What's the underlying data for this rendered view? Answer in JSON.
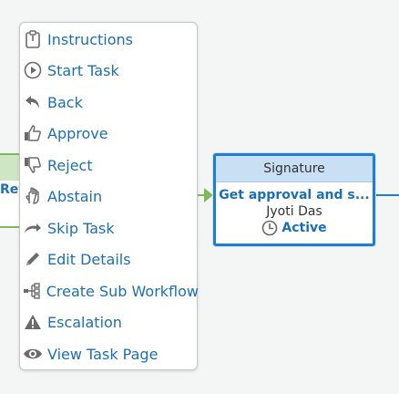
{
  "menu": {
    "items": [
      {
        "label": "Instructions",
        "icon": "clipboard-icon"
      },
      {
        "label": "Start Task",
        "icon": "play-circle-icon"
      },
      {
        "label": "Back",
        "icon": "reply-arrow-icon"
      },
      {
        "label": "Approve",
        "icon": "thumbs-up-icon"
      },
      {
        "label": "Reject",
        "icon": "thumbs-down-icon"
      },
      {
        "label": "Abstain",
        "icon": "hand-icon"
      },
      {
        "label": "Skip Task",
        "icon": "skip-arrow-icon"
      },
      {
        "label": "Edit Details",
        "icon": "pencil-icon"
      },
      {
        "label": "Create Sub Workflow",
        "icon": "sitemap-icon"
      },
      {
        "label": "Escalation",
        "icon": "warning-icon"
      },
      {
        "label": "View Task Page",
        "icon": "eye-icon"
      }
    ]
  },
  "task_node": {
    "header": "Signature",
    "title": "Get approval and s...",
    "assignee": "Jyoti Das",
    "status": "Active",
    "status_icon": "clock-icon"
  },
  "left_node": {
    "label_fragment": "Rev"
  },
  "colors": {
    "link_blue": "#1d6fb3",
    "node_border": "#1e7fd0",
    "node_header": "#c9dff4",
    "connector_green": "#7dba5b",
    "icon_gray": "#6b6b6b"
  }
}
